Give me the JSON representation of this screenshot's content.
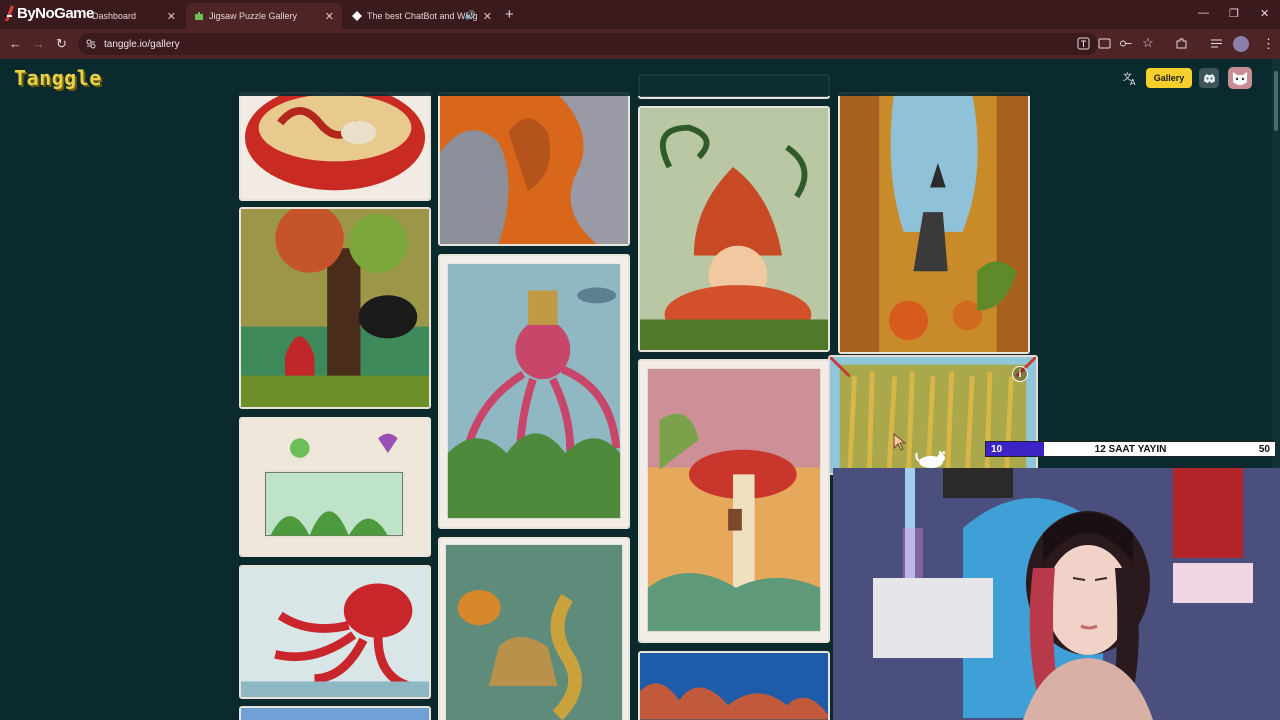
{
  "streamer_logo": "ByNoGame",
  "tabs": [
    {
      "title": "Dashboard"
    },
    {
      "title": "Jigsaw Puzzle Gallery"
    },
    {
      "title": "The best ChatBot and Widg"
    }
  ],
  "address_bar": {
    "url": "tanggle.io/gallery"
  },
  "site": {
    "logo": "Tanggle",
    "gallery_button": "Gallery",
    "info_glyph": "i"
  },
  "stream_overlay": {
    "progress_current": "10",
    "progress_title": "12 SAAT YAYIN",
    "progress_max": "50",
    "progress_fraction": 0.2
  },
  "colors": {
    "page_bg": "#0b2a2e",
    "accent_gallery": "#f5cf2b",
    "logo": "#e7d24a",
    "progress_fill": "#3b23c5",
    "chrome_tabbar": "#3a1a1c",
    "chrome_toolbar": "#4f2426"
  },
  "icons": [
    "translate-icon",
    "discord-icon",
    "avatar-icon",
    "info-icon",
    "back-icon",
    "forward-icon",
    "reload-icon",
    "site-info-icon",
    "star-icon",
    "extensions-icon",
    "menu-icon"
  ]
}
